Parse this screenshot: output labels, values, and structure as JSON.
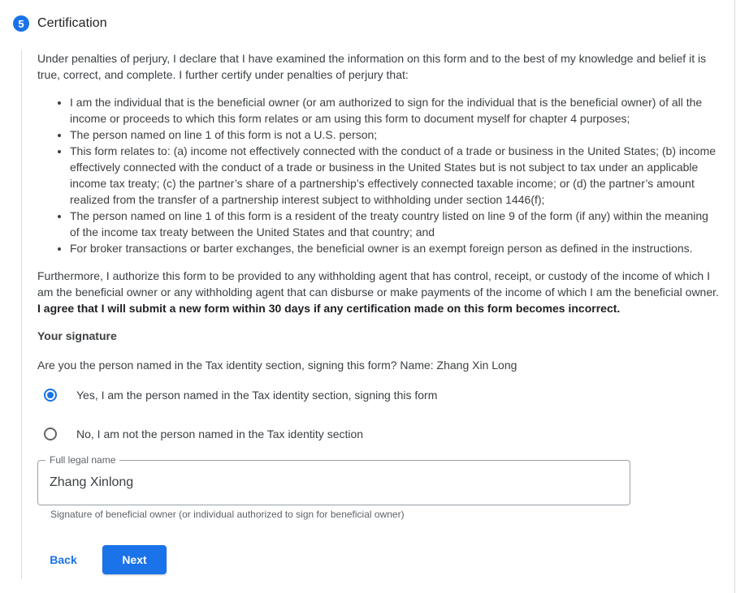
{
  "step": {
    "number": "5",
    "title": "Certification"
  },
  "certification": {
    "intro": "Under penalties of perjury, I declare that I have examined the information on this form and to the best of my knowledge and belief it is true, correct, and complete. I further certify under penalties of perjury that:",
    "bullets": [
      "I am the individual that is the beneficial owner (or am authorized to sign for the individual that is the beneficial owner) of all the income or proceeds to which this form relates or am using this form to document myself for chapter 4 purposes;",
      "The person named on line 1 of this form is not a U.S. person;",
      "This form relates to: (a) income not effectively connected with the conduct of a trade or business in the United States; (b) income effectively connected with the conduct of a trade or business in the United States but is not subject to tax under an applicable income tax treaty; (c) the partner’s share of a partnership’s effectively connected taxable income; or (d) the partner’s amount realized from the transfer of a partnership interest subject to withholding under section 1446(f);",
      "The person named on line 1 of this form is a resident of the treaty country listed on line 9 of the form (if any) within the meaning of the income tax treaty between the United States and that country; and",
      "For broker transactions or barter exchanges, the beneficial owner is an exempt foreign person as defined in the instructions."
    ],
    "authorization": "Furthermore, I authorize this form to be provided to any withholding agent that has control, receipt, or custody of the income of which I am the beneficial owner or any withholding agent that can disburse or make payments of the income of which I am the beneficial owner. ",
    "authorization_bold": "I agree that I will submit a new form within 30 days if any certification made on this form becomes incorrect."
  },
  "signature": {
    "heading": "Your signature",
    "question": "Are you the person named in the Tax identity section, signing this form? Name: Zhang Xin Long",
    "options": [
      {
        "label": "Yes, I am the person named in the Tax identity section, signing this form",
        "selected": true
      },
      {
        "label": "No, I am not the person named in the Tax identity section",
        "selected": false
      }
    ],
    "field": {
      "label": "Full legal name",
      "value": "Zhang Xinlong",
      "helper": "Signature of beneficial owner (or individual authorized to sign for beneficial owner)"
    }
  },
  "actions": {
    "back_label": "Back",
    "next_label": "Next"
  },
  "colors": {
    "accent": "#1a73e8",
    "text": "#3c4043",
    "border": "#dadce0"
  }
}
